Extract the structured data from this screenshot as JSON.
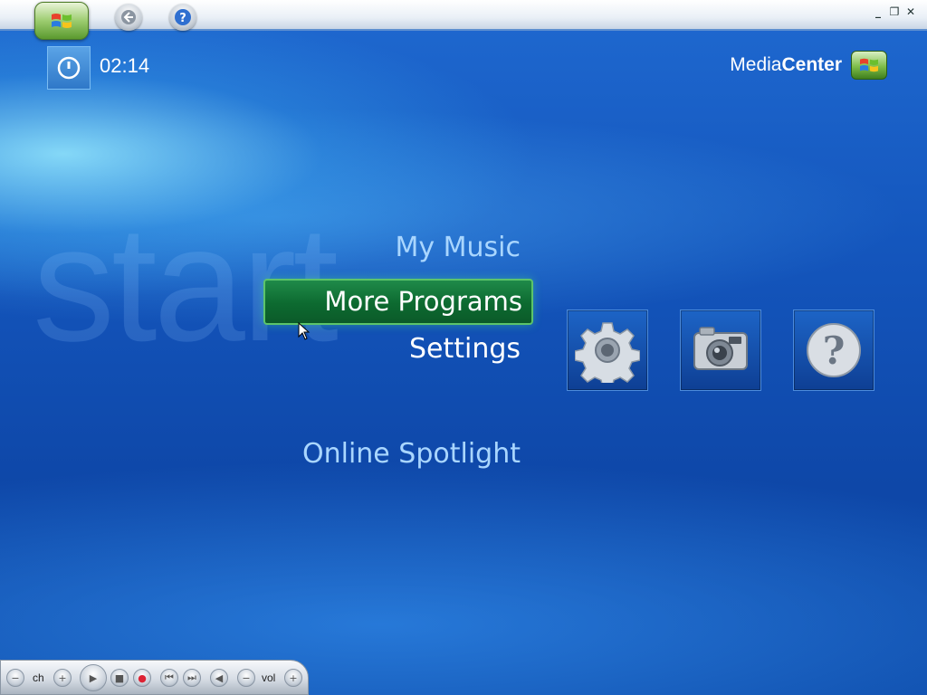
{
  "titlebar": {
    "window_controls": {
      "minimize_icon": "minimize-icon",
      "restore_icon": "restore-icon",
      "close_icon": "close-icon"
    },
    "buttons": [
      "start-button",
      "back-button",
      "help-button"
    ]
  },
  "status": {
    "clock": "02:14"
  },
  "logo": {
    "media": "Media",
    "center": "Center"
  },
  "watermark": "start",
  "menu": {
    "items": [
      "My Music",
      "More Programs",
      "Settings",
      "Online Spotlight"
    ],
    "selected": "More Programs"
  },
  "tiles": [
    {
      "icon": "gear-icon"
    },
    {
      "icon": "camera-icon"
    },
    {
      "icon": "help-icon"
    }
  ],
  "transport": {
    "channel_label": "ch",
    "volume_label": "vol"
  },
  "colors": {
    "accent_green": "#1f8a4a",
    "menu_text": "#a9d6ff",
    "background": "#1456bd"
  }
}
